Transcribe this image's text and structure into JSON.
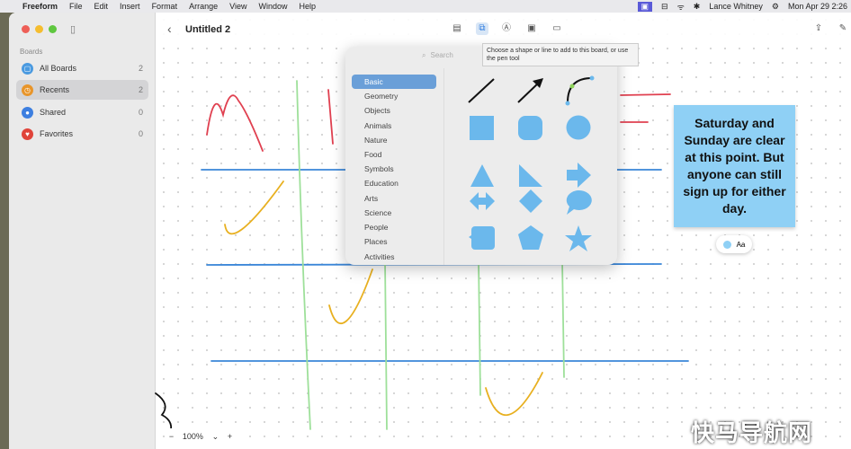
{
  "menubar": {
    "app": "Freeform",
    "items": [
      "File",
      "Edit",
      "Insert",
      "Format",
      "Arrange",
      "View",
      "Window",
      "Help"
    ],
    "user": "Lance Whitney",
    "clock": "Mon Apr 29  2:26"
  },
  "sidebar": {
    "heading": "Boards",
    "items": [
      {
        "label": "All Boards",
        "count": "2",
        "color": "#4a9ae0"
      },
      {
        "label": "Recents",
        "count": "2",
        "color": "#e8952a"
      },
      {
        "label": "Shared",
        "count": "0",
        "color": "#3d7fe0"
      },
      {
        "label": "Favorites",
        "count": "0",
        "color": "#e0443a"
      }
    ],
    "selected": "Recents"
  },
  "board": {
    "title": "Untitled 2",
    "zoom": "100%"
  },
  "tooltip": "Choose a shape or line to add to this board, or use the pen tool",
  "picker": {
    "search_placeholder": "Search",
    "categories": [
      "Basic",
      "Geometry",
      "Objects",
      "Animals",
      "Nature",
      "Food",
      "Symbols",
      "Education",
      "Arts",
      "Science",
      "People",
      "Places",
      "Activities"
    ],
    "selected": "Basic",
    "shape_color": "#6bb8ec"
  },
  "note": {
    "text": "Saturday and Sunday are clear at this point. But anyone can still sign up for either day.",
    "color": "#8fd0f5",
    "format_label": "Aa"
  },
  "watermark": "快马导航网"
}
